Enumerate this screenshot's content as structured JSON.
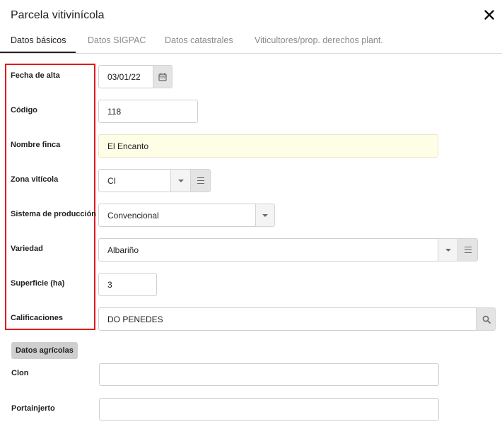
{
  "dialog": {
    "title": "Parcela vitivinícola",
    "close_icon": "close-icon"
  },
  "tabs": [
    {
      "label": "Datos básicos",
      "active": true
    },
    {
      "label": "Datos SIGPAC",
      "active": false
    },
    {
      "label": "Datos catastrales",
      "active": false
    },
    {
      "label": "Viticultores/prop. derechos plant.",
      "active": false
    }
  ],
  "fields": {
    "fecha_alta": {
      "label": "Fecha de alta",
      "value": "03/01/22",
      "icon": "calendar-icon"
    },
    "codigo": {
      "label": "Código",
      "value": "118"
    },
    "nombre_finca": {
      "label": "Nombre finca",
      "value": "El Encanto"
    },
    "zona_viticola": {
      "label": "Zona vitícola",
      "value": "CI",
      "icons": [
        "chevron-down-icon",
        "list-icon"
      ]
    },
    "sistema_produccion": {
      "label": "Sistema de producción",
      "value": "Convencional",
      "icons": [
        "chevron-down-icon"
      ]
    },
    "variedad": {
      "label": "Variedad",
      "value": "Albariño",
      "icons": [
        "chevron-down-icon",
        "list-icon"
      ]
    },
    "superficie": {
      "label": "Superficie (ha)",
      "value": "3"
    },
    "calificaciones": {
      "label": "Calificaciones",
      "value": "DO PENEDES",
      "icon": "search-icon"
    }
  },
  "datos_agricolas": {
    "section_label": "Datos agrícolas",
    "clon": {
      "label": "Clon",
      "value": ""
    },
    "portainjerto": {
      "label": "Portainjerto",
      "value": ""
    }
  },
  "colors": {
    "highlight": "#e0191c",
    "active_tab": "#212121",
    "yellow_field": "#fefee6"
  }
}
